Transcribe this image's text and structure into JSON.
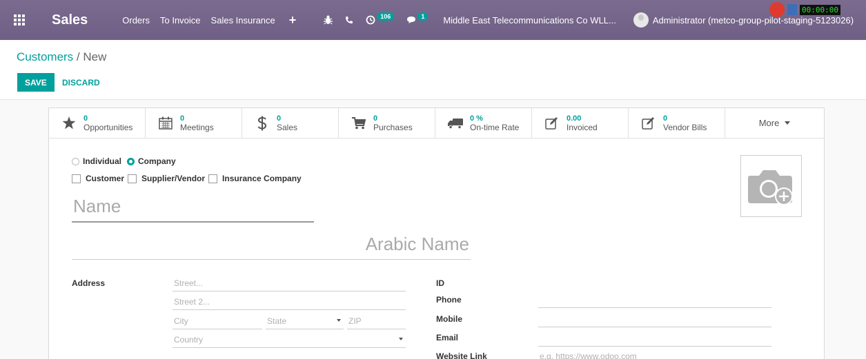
{
  "navbar": {
    "app_name": "Sales",
    "menu": [
      "Orders",
      "To Invoice",
      "Sales Insurance"
    ],
    "plus": "+",
    "activity_count": "106",
    "message_count": "1",
    "company": "Middle East Telecommunications Co WLL...",
    "user": "Administrator (metco-group-pilot-staging-5123026)",
    "overlay_digits": "00:00:00"
  },
  "breadcrumb": {
    "parent": "Customers",
    "separator": "/",
    "current": "New"
  },
  "actions": {
    "save": "SAVE",
    "discard": "DISCARD"
  },
  "smart_buttons": [
    {
      "value": "0",
      "label": "Opportunities",
      "icon": "star-icon"
    },
    {
      "value": "0",
      "label": "Meetings",
      "icon": "calendar-icon"
    },
    {
      "value": "0",
      "label": "Sales",
      "icon": "dollar-icon"
    },
    {
      "value": "0",
      "label": "Purchases",
      "icon": "cart-icon"
    },
    {
      "value": "0 %",
      "label": "On-time Rate",
      "icon": "truck-icon"
    },
    {
      "value": "0.00",
      "label": "Invoiced",
      "icon": "edit-icon"
    },
    {
      "value": "0",
      "label": "Vendor Bills",
      "icon": "edit-icon"
    }
  ],
  "more": "More",
  "type_radio": {
    "individual": "Individual",
    "company": "Company",
    "selected": "Company"
  },
  "checks": {
    "customer": "Customer",
    "supplier": "Supplier/Vendor",
    "insurance": "Insurance Company"
  },
  "name_placeholder": "Name",
  "arabic_placeholder": "Arabic Name",
  "address": {
    "label": "Address",
    "street": "Street...",
    "street2": "Street 2...",
    "city": "City",
    "state": "State",
    "zip": "ZIP",
    "country": "Country"
  },
  "right_fields": {
    "id": "ID",
    "phone": "Phone",
    "mobile": "Mobile",
    "email": "Email",
    "website": "Website Link",
    "website_placeholder": "e.g. https://www.odoo.com"
  },
  "colors": {
    "navbar": "#6f5f85",
    "accent": "#00a09d"
  }
}
